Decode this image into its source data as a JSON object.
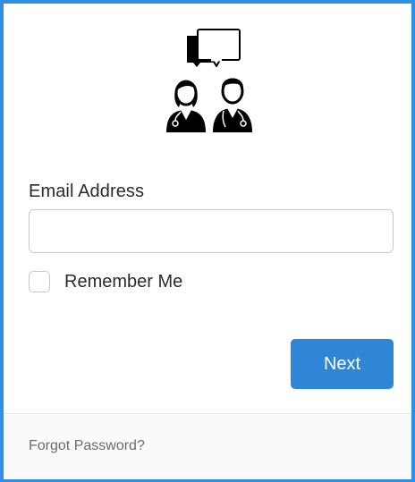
{
  "logo": {
    "icon": "doctors-chat-icon"
  },
  "form": {
    "email_label": "Email Address",
    "email_value": "",
    "email_placeholder": "",
    "remember_label": "Remember Me",
    "remember_checked": false,
    "next_label": "Next"
  },
  "footer": {
    "forgot_password": "Forgot Password?"
  },
  "colors": {
    "frame": "#2f8fe6",
    "button": "#2f86d6",
    "text": "#2a2a2a",
    "muted": "#6b6b6b"
  }
}
